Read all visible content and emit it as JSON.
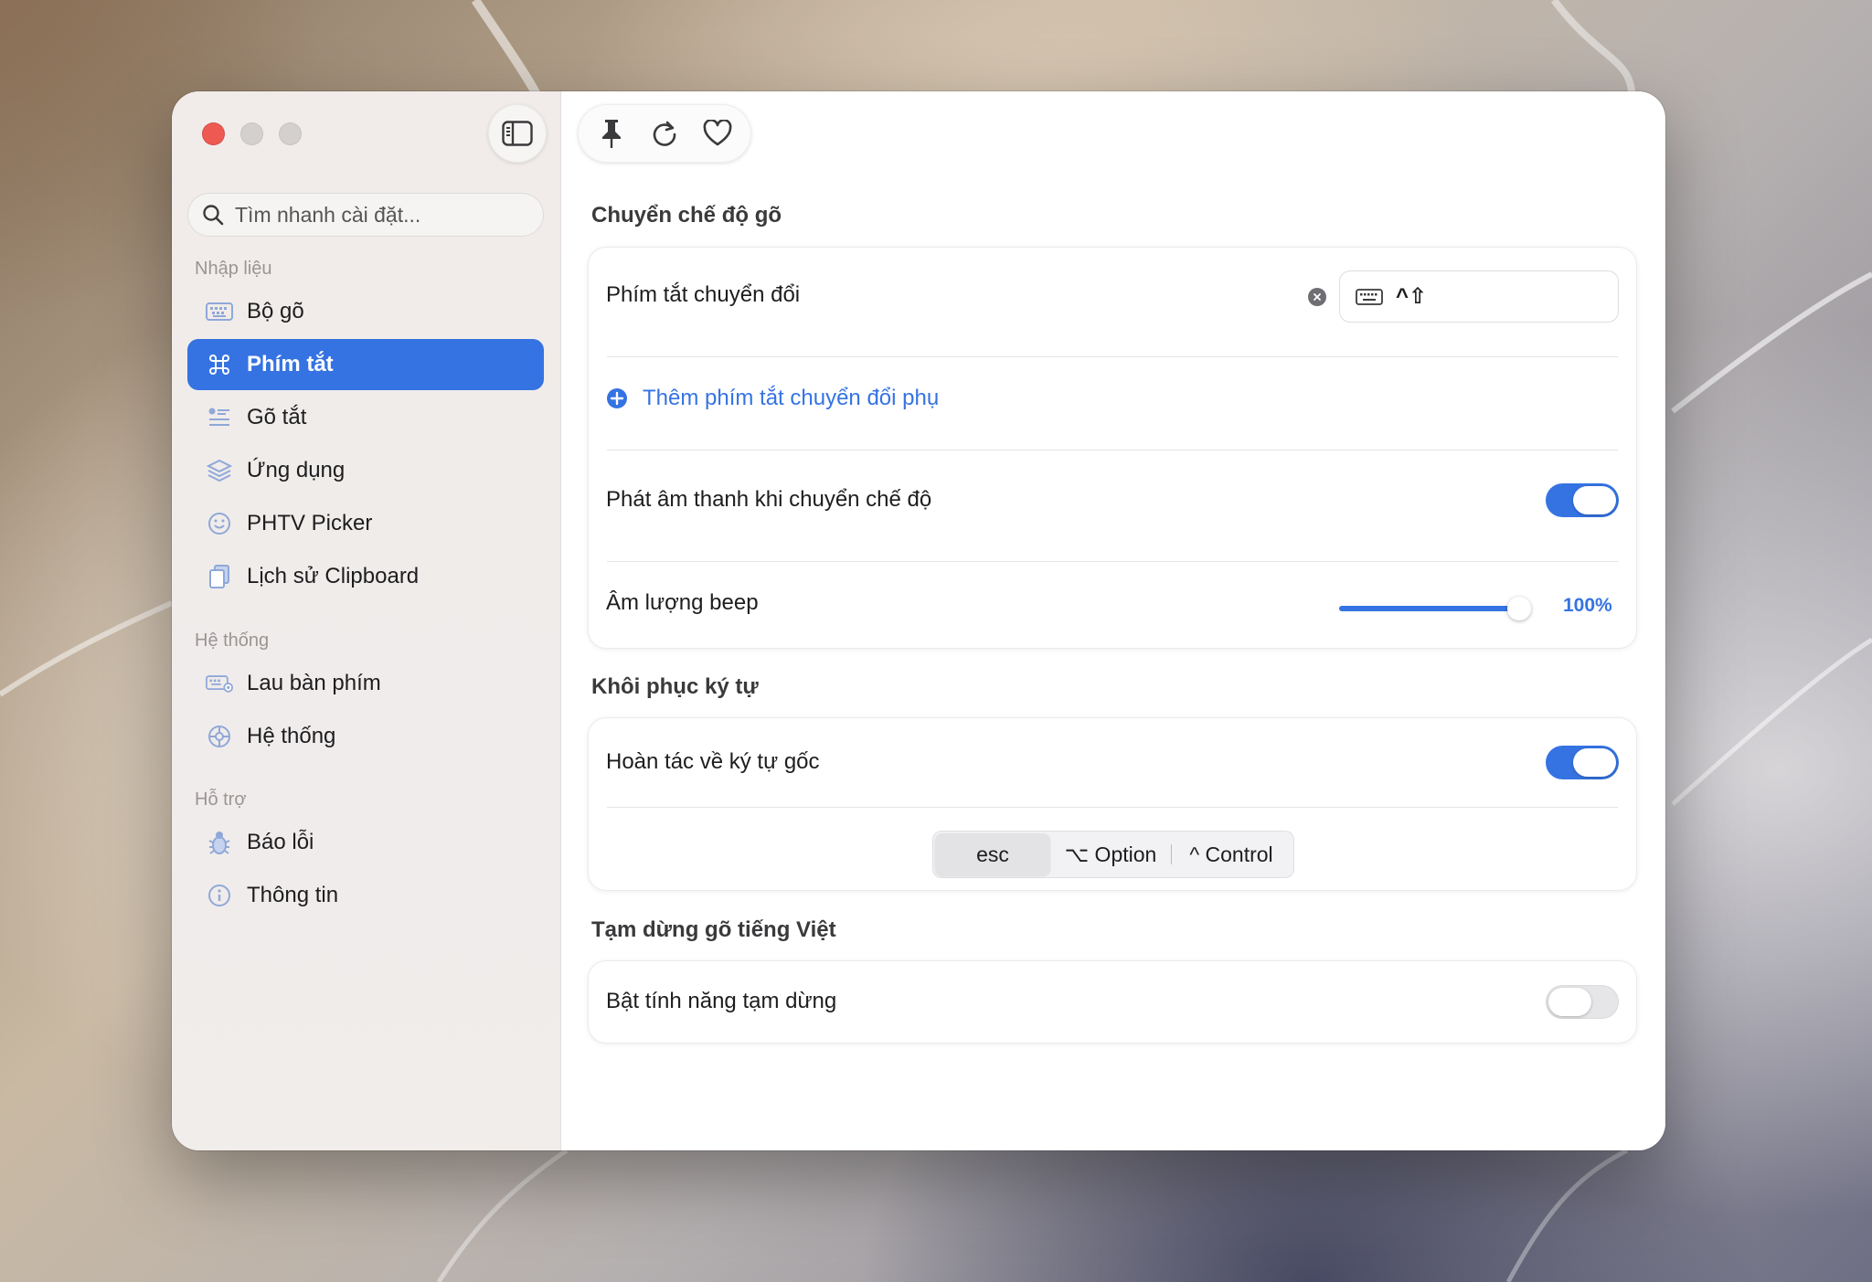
{
  "window": {
    "sidebar_toggle_icon": "sidebar-icon"
  },
  "sidebar": {
    "search_placeholder": "Tìm nhanh cài đặt...",
    "sections": [
      {
        "label": "Nhập liệu"
      },
      {
        "label": "Hệ thống"
      },
      {
        "label": "Hỗ trợ"
      }
    ],
    "items": [
      {
        "label": "Bộ gõ",
        "icon": "keyboard-icon"
      },
      {
        "label": "Phím tắt",
        "icon": "command-icon",
        "active": true
      },
      {
        "label": "Gõ tắt",
        "icon": "text-list-icon"
      },
      {
        "label": "Ứng dụng",
        "icon": "stack-icon"
      },
      {
        "label": "PHTV Picker",
        "icon": "smiley-icon"
      },
      {
        "label": "Lịch sử Clipboard",
        "icon": "clipboard-icon"
      },
      {
        "label": "Lau bàn phím",
        "icon": "keyboard-clean-icon"
      },
      {
        "label": "Hệ thống",
        "icon": "gear-icon"
      },
      {
        "label": "Báo lỗi",
        "icon": "bug-icon"
      },
      {
        "label": "Thông tin",
        "icon": "info-icon"
      }
    ]
  },
  "toolbar": {
    "buttons": [
      "pin-icon",
      "refresh-icon",
      "heart-icon"
    ]
  },
  "groups": {
    "switch_mode": {
      "title": "Chuyển chế độ gõ",
      "shortcut_label": "Phím tắt chuyển đổi",
      "shortcut_value": "^⇧",
      "add_secondary": "Thêm phím tắt chuyển đổi phụ",
      "play_sound_label": "Phát âm thanh khi chuyển chế độ",
      "play_sound_on": true,
      "beep_volume_label": "Âm lượng beep",
      "beep_volume_percent": 100,
      "beep_volume_text": "100%"
    },
    "restore": {
      "title": "Khôi phục ký tự",
      "undo_label": "Hoàn tác về ký tự gốc",
      "undo_on": true,
      "keys": [
        {
          "label": "esc",
          "selected": true
        },
        {
          "label": "⌥ Option",
          "selected": false
        },
        {
          "label": "^ Control",
          "selected": false
        }
      ]
    },
    "pause": {
      "title": "Tạm dừng gõ tiếng Việt",
      "enable_label": "Bật tính năng tạm dừng",
      "enable_on": false
    }
  },
  "colors": {
    "accent": "#3573e2",
    "close": "#ee5a52"
  }
}
